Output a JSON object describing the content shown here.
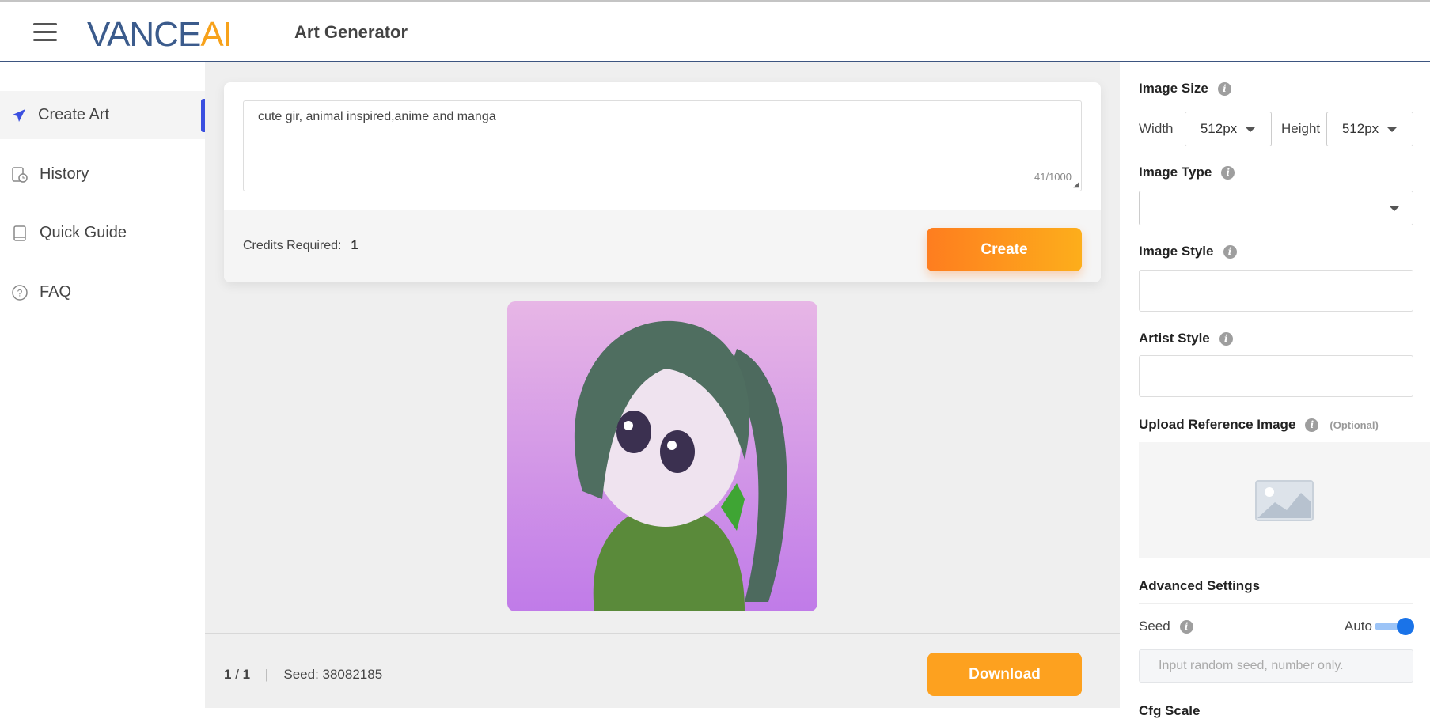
{
  "header": {
    "logo_primary": "VANCE",
    "logo_accent": "AI",
    "title": "Art Generator"
  },
  "sidebar": {
    "items": [
      {
        "label": "Create Art",
        "icon": "paper-plane-icon",
        "active": true
      },
      {
        "label": "History",
        "icon": "history-icon"
      },
      {
        "label": "Quick Guide",
        "icon": "book-icon"
      },
      {
        "label": "FAQ",
        "icon": "question-circle-icon"
      }
    ],
    "active_color": "#3a4fe0"
  },
  "prompt": {
    "value": "cute gir, animal inspired,anime and manga",
    "count": "41/1000"
  },
  "credits": {
    "label": "Credits Required:",
    "value": "1"
  },
  "create_label": "Create",
  "result": {
    "page": "1",
    "separator": "/",
    "total": "1",
    "divider": "|",
    "seed": "Seed: 38082185"
  },
  "download_label": "Download",
  "settings": {
    "image_size": "Image Size",
    "width_label": "Width",
    "width_value": "512px",
    "height_label": "Height",
    "height_value": "512px",
    "image_type": "Image Type",
    "image_type_value": "",
    "image_style": "Image Style",
    "artist_style": "Artist Style",
    "upload": "Upload Reference Image",
    "optional": "(Optional)",
    "advanced": "Advanced Settings",
    "seed": "Seed",
    "auto": "Auto",
    "auto_on": true,
    "seed_placeholder": "Input random seed, number only.",
    "cfg": "Cfg Scale"
  },
  "colors": {
    "accent_orange": "#fe7d1f",
    "brand_blue": "#3b5b8c",
    "toggle_blue": "#1a73e8"
  }
}
